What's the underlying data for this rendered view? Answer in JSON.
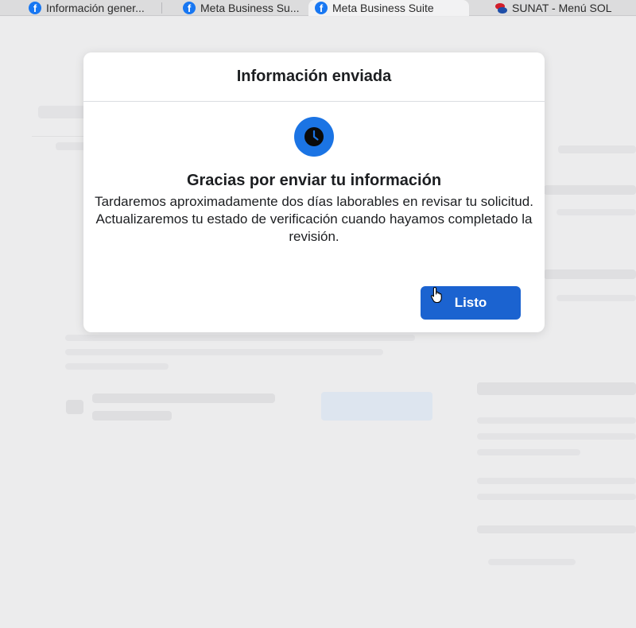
{
  "browser": {
    "tabs": [
      {
        "label": "Información gener...",
        "icon": "facebook-icon",
        "active": false
      },
      {
        "label": "Meta Business Su...",
        "icon": "facebook-icon",
        "active": false
      },
      {
        "label": "Meta Business Suite",
        "icon": "facebook-icon",
        "active": true
      },
      {
        "label": "SUNAT - Menú SOL",
        "icon": "sunat-icon",
        "active": false
      }
    ]
  },
  "modal": {
    "title": "Información enviada",
    "icon": "clock-icon",
    "heading": "Gracias por enviar tu información",
    "body": "Tardaremos aproximadamente dos días laborables en revisar tu solicitud. Actualizaremos tu estado de verificación cuando hayamos completado la revisión.",
    "done_label": "Listo"
  },
  "colors": {
    "accent": "#1b74e4",
    "button": "#1b63d0",
    "facebook": "#1877f2"
  }
}
